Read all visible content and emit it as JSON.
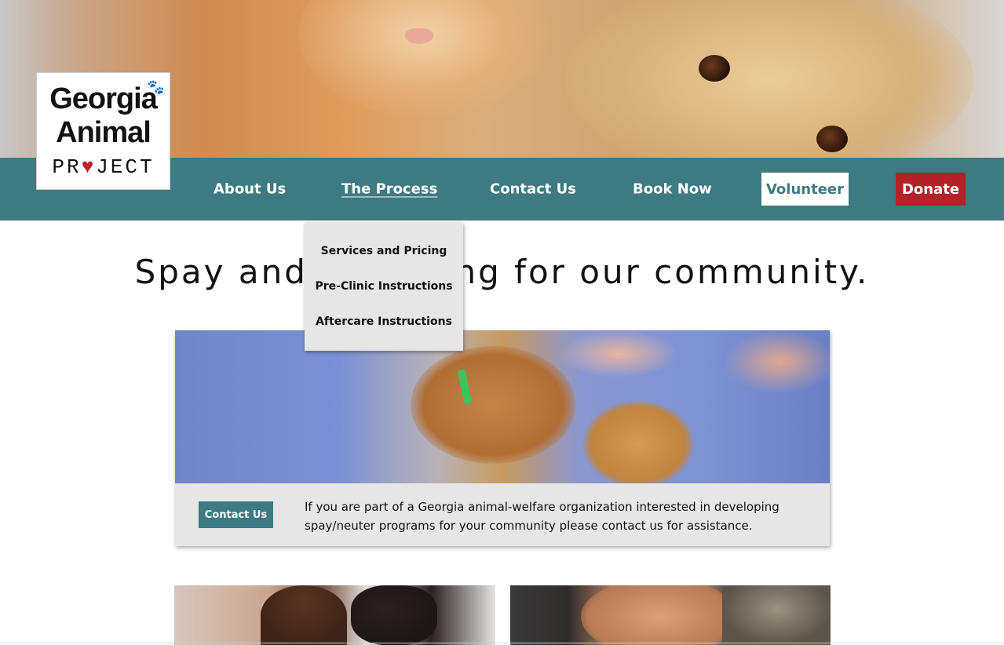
{
  "logo": {
    "line1": "Georgia",
    "line2": "Animal",
    "line3_before": "PR",
    "line3_heart": "♥",
    "line3_after": "JECT"
  },
  "nav": {
    "items": [
      {
        "label": "About Us"
      },
      {
        "label": "The Process",
        "active": true
      },
      {
        "label": "Contact Us"
      },
      {
        "label": "Book Now"
      }
    ],
    "volunteer_label": "Volunteer",
    "donate_label": "Donate"
  },
  "dropdown": {
    "items": [
      {
        "label": "Services and Pricing"
      },
      {
        "label": "Pre-Clinic Instructions"
      },
      {
        "label": "Aftercare Instructions"
      }
    ]
  },
  "headline": "Spay and neutering for our community.",
  "card": {
    "button_label": "Contact Us",
    "text": "If you are part of a Georgia animal-welfare organization interested in developing spay/neuter programs for your community please contact us for assistance."
  },
  "colors": {
    "teal": "#3d7a82",
    "red": "#b42126",
    "dropdown_bg": "#e6e6e6"
  }
}
